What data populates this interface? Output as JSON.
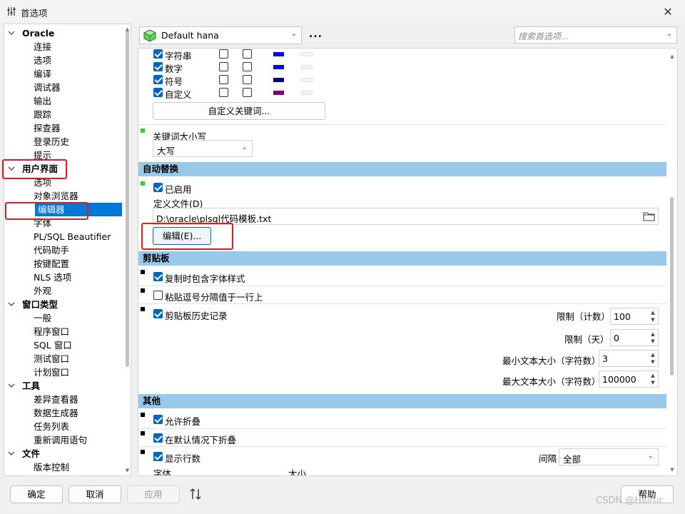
{
  "window": {
    "title": "首选项"
  },
  "tree": {
    "categories": [
      {
        "label": "Oracle",
        "items": [
          "连接",
          "选项",
          "编译",
          "调试器",
          "输出",
          "跟踪",
          "探查器",
          "登录历史",
          "提示"
        ]
      },
      {
        "label": "用户界面",
        "items": [
          "选项",
          "对象浏览器",
          "编辑器",
          "字体",
          "PL/SQL Beautifier",
          "代码助手",
          "按键配置",
          "NLS 选项",
          "外观"
        ]
      },
      {
        "label": "窗口类型",
        "items": [
          "一般",
          "程序窗口",
          "SQL 窗口",
          "测试窗口",
          "计划窗口"
        ]
      },
      {
        "label": "工具",
        "items": [
          "差异查看器",
          "数据生成器",
          "任务列表",
          "重新调用语句"
        ]
      },
      {
        "label": "文件",
        "items": [
          "版本控制"
        ]
      }
    ],
    "selected": "编辑器"
  },
  "toolbar": {
    "profile": "Default hana",
    "more": "...",
    "search_placeholder": "搜索首选项..."
  },
  "syntax": {
    "rows": [
      {
        "label": "字符串",
        "color": "#0000ff"
      },
      {
        "label": "数字",
        "color": "#0000ff"
      },
      {
        "label": "符号",
        "color": "#000080"
      },
      {
        "label": "自定义",
        "color": "#800080"
      }
    ],
    "custom_keywords_button": "自定义关键词..."
  },
  "keyword_case": {
    "label": "关键词大小写",
    "value": "大写"
  },
  "autoreplace": {
    "header": "自动替换",
    "enabled_label": "已启用",
    "file_label": "定义文件(D)",
    "file_value": "D:\\oracle\\plsql代码模板.txt",
    "edit_button": "编辑(E)..."
  },
  "clipboard": {
    "header": "剪贴板",
    "include_font": "复制时包含字体样式",
    "paste_comma": "粘贴逗号分隔值于一行上",
    "history": "剪贴板历史记录",
    "limit_count_label": "限制（计数）",
    "limit_count_value": "100",
    "limit_days_label": "限制（天）",
    "limit_days_value": "0",
    "min_size_label": "最小文本大小（字符数）",
    "min_size_value": "3",
    "max_size_label": "最大文本大小（字符数）",
    "max_size_value": "100000"
  },
  "other": {
    "header": "其他",
    "allow_fold": "允许折叠",
    "default_fold": "在默认情况下折叠",
    "show_line_numbers": "显示行数",
    "interval_label": "间隔",
    "interval_value": "全部",
    "font_label": "字体",
    "size_label": "大小"
  },
  "buttons": {
    "ok": "确定",
    "cancel": "取消",
    "apply": "应用",
    "help": "帮助"
  },
  "watermark": "CSDN @Hvitur"
}
